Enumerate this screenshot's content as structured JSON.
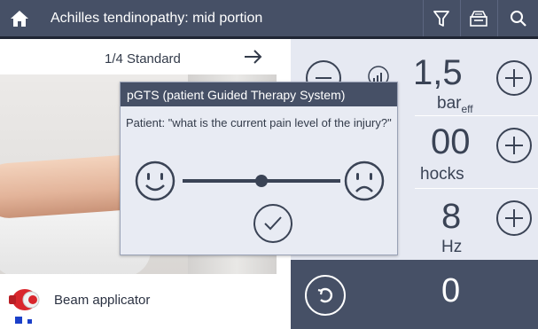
{
  "header": {
    "title": "Achilles tendinopathy: mid portion",
    "icons": [
      "home-icon",
      "filter-icon",
      "database-icon",
      "search-icon"
    ]
  },
  "protocol": {
    "step_label": "1/4 Standard",
    "next_icon": "arrow-right-icon"
  },
  "applicator": {
    "label": "Beam applicator",
    "icon": "beam-applicator-icon"
  },
  "parameters": {
    "pressure": {
      "value": "1,5",
      "unit": "bar",
      "unit_sub": "eff"
    },
    "shocks": {
      "value": "00",
      "unit": "hocks"
    },
    "frequency": {
      "value": "8",
      "unit": "Hz"
    }
  },
  "counter": {
    "value": "0"
  },
  "dialog": {
    "title": "pGTS (patient Guided Therapy System)",
    "question": "Patient: \"what is the current pain level of the injury?\"",
    "pain_level": 0.5
  },
  "colors": {
    "header_bg": "#465066",
    "panel_bg": "#e6e9f2",
    "accent_blue": "#1b40c9",
    "applicator_red": "#d9262c"
  }
}
